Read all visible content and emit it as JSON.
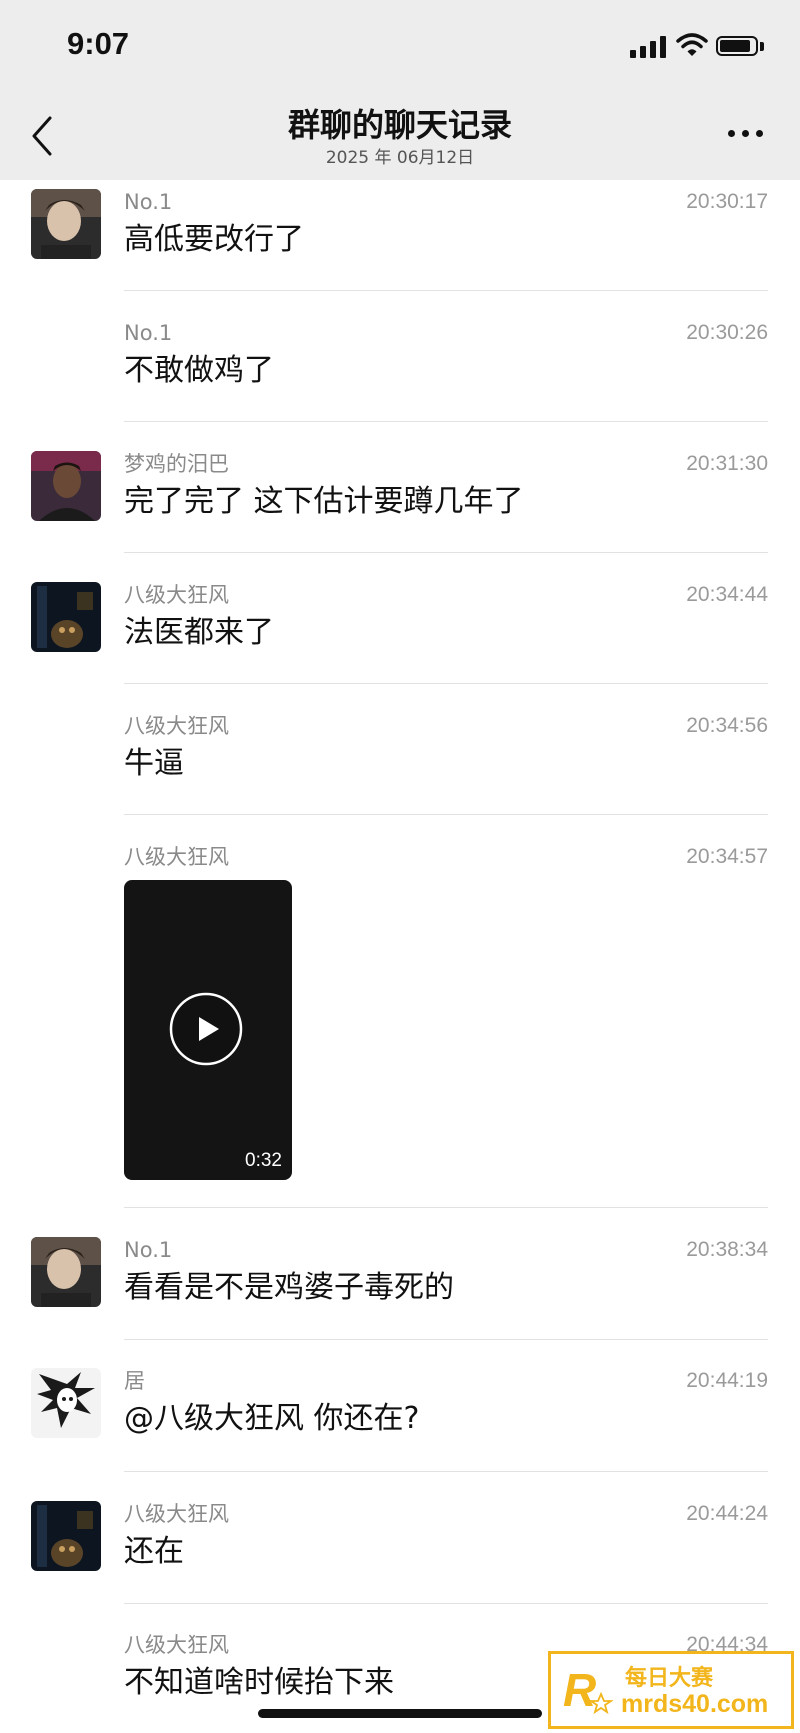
{
  "status_bar": {
    "time": "9:07"
  },
  "header": {
    "title": "群聊的聊天记录",
    "subtitle": "2025 年 06月12日"
  },
  "messages": [
    {
      "sender": "No.1",
      "time": "20:30:17",
      "text": "高低要改行了",
      "avatar": true
    },
    {
      "sender": "No.1",
      "time": "20:30:26",
      "text": "不敢做鸡了",
      "avatar": false
    },
    {
      "sender": "梦鸡的汨巴",
      "time": "20:31:30",
      "text": "完了完了 这下估计要蹲几年了",
      "avatar": true
    },
    {
      "sender": "八级大狂风",
      "time": "20:34:44",
      "text": "法医都来了",
      "avatar": true
    },
    {
      "sender": "八级大狂风",
      "time": "20:34:56",
      "text": "牛逼",
      "avatar": false
    },
    {
      "sender": "八级大狂风",
      "time": "20:34:57",
      "video_duration": "0:32",
      "avatar": false
    },
    {
      "sender": "No.1",
      "time": "20:38:34",
      "text": "看看是不是鸡婆子毒死的",
      "avatar": true
    },
    {
      "sender": "居",
      "time": "20:44:19",
      "text": "@八级大狂风 你还在?",
      "avatar": true
    },
    {
      "sender": "八级大狂风",
      "time": "20:44:24",
      "text": "还在",
      "avatar": true
    },
    {
      "sender": "八级大狂风",
      "time": "20:44:34",
      "text": "不知道啥时候抬下来",
      "avatar": false
    }
  ],
  "watermark": {
    "brand": "每日大赛",
    "url": "mrds40.com"
  },
  "colors": {
    "header_bg": "#ededed",
    "watermark": "#f2b51b"
  }
}
